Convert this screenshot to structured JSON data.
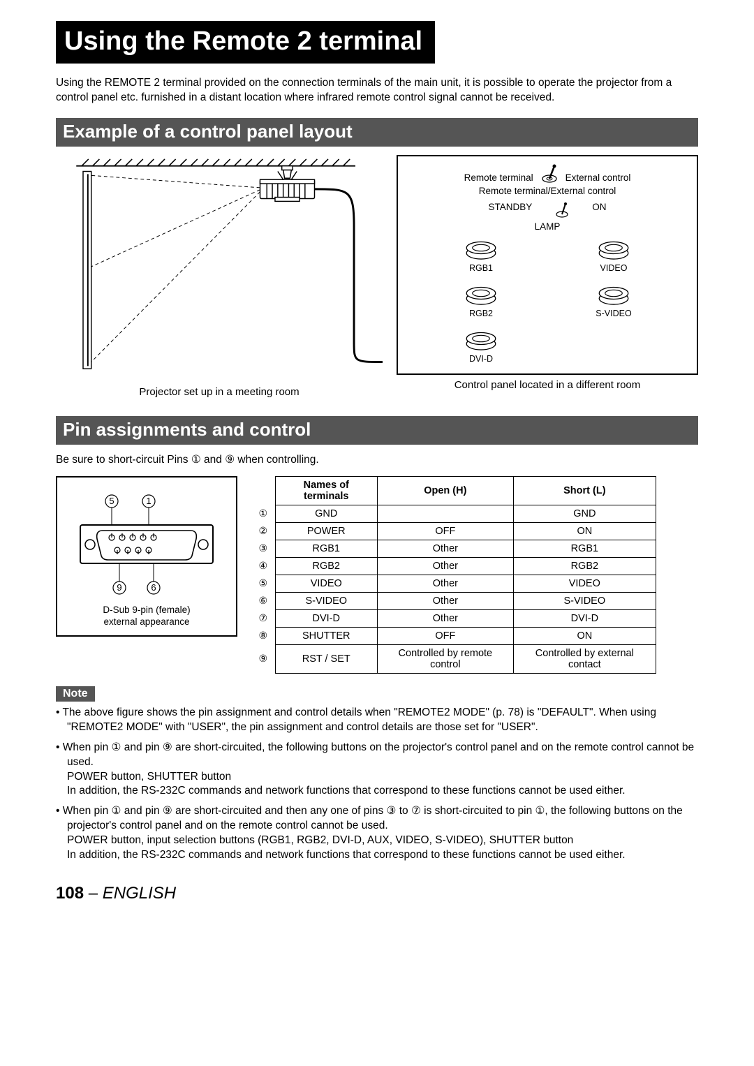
{
  "title": "Using the Remote 2 terminal",
  "intro": "Using the REMOTE 2 terminal provided on the connection terminals of the main unit, it is possible to operate the projector from a control panel etc. furnished in a distant location where infrared remote control signal cannot be received.",
  "section1_title": "Example of a control panel layout",
  "diagram": {
    "left_caption": "Projector set up in a meeting room",
    "right_caption": "Control panel located in a different room"
  },
  "panel": {
    "remote_terminal": "Remote terminal",
    "external_control": "External control",
    "combo": "Remote terminal/External control",
    "standby": "STANDBY",
    "on": "ON",
    "lamp": "LAMP",
    "buttons": {
      "rgb1": "RGB1",
      "video": "VIDEO",
      "rgb2": "RGB2",
      "svideo": "S-VIDEO",
      "dvid": "DVI-D"
    }
  },
  "section2_title": "Pin assignments and control",
  "pin_note": "Be sure to short-circuit Pins ① and ⑨ when controlling.",
  "pin_caption_line1": "D-Sub 9-pin (female)",
  "pin_caption_line2": "external appearance",
  "table": {
    "headers": {
      "names": "Names of terminals",
      "open": "Open (H)",
      "short": "Short (L)"
    },
    "rows": [
      {
        "num": "①",
        "name": "GND",
        "open": "",
        "short": "GND"
      },
      {
        "num": "②",
        "name": "POWER",
        "open": "OFF",
        "short": "ON"
      },
      {
        "num": "③",
        "name": "RGB1",
        "open": "Other",
        "short": "RGB1"
      },
      {
        "num": "④",
        "name": "RGB2",
        "open": "Other",
        "short": "RGB2"
      },
      {
        "num": "⑤",
        "name": "VIDEO",
        "open": "Other",
        "short": "VIDEO"
      },
      {
        "num": "⑥",
        "name": "S-VIDEO",
        "open": "Other",
        "short": "S-VIDEO"
      },
      {
        "num": "⑦",
        "name": "DVI-D",
        "open": "Other",
        "short": "DVI-D"
      },
      {
        "num": "⑧",
        "name": "SHUTTER",
        "open": "OFF",
        "short": "ON"
      },
      {
        "num": "⑨",
        "name": "RST / SET",
        "open": "Controlled by remote control",
        "short": "Controlled by external contact"
      }
    ]
  },
  "note_label": "Note",
  "notes": [
    "The above figure shows the pin assignment and control details when \"REMOTE2 MODE\" (p. 78) is \"DEFAULT\". When using \"REMOTE2 MODE\" with \"USER\", the pin assignment and control details are those set for \"USER\".",
    "When pin ① and pin ⑨ are short-circuited, the following buttons on the projector's control panel and on the remote control cannot be used.\nPOWER button, SHUTTER button\nIn addition, the RS-232C commands and network functions that correspond to these functions cannot be used either.",
    "When pin ① and pin ⑨ are short-circuited and then any one of pins ③ to ⑦ is short-circuited to pin ①, the following buttons on the projector's control panel and on the remote control cannot be used.\nPOWER button, input selection buttons (RGB1, RGB2, DVI-D, AUX, VIDEO, S-VIDEO), SHUTTER button\nIn addition, the RS-232C commands and network functions that correspond to these functions cannot be used either."
  ],
  "footer": {
    "page": "108",
    "sep": " – ",
    "lang": "ENGLISH"
  },
  "pin_labels": {
    "p1": "1",
    "p5": "5",
    "p6": "6",
    "p9": "9"
  }
}
